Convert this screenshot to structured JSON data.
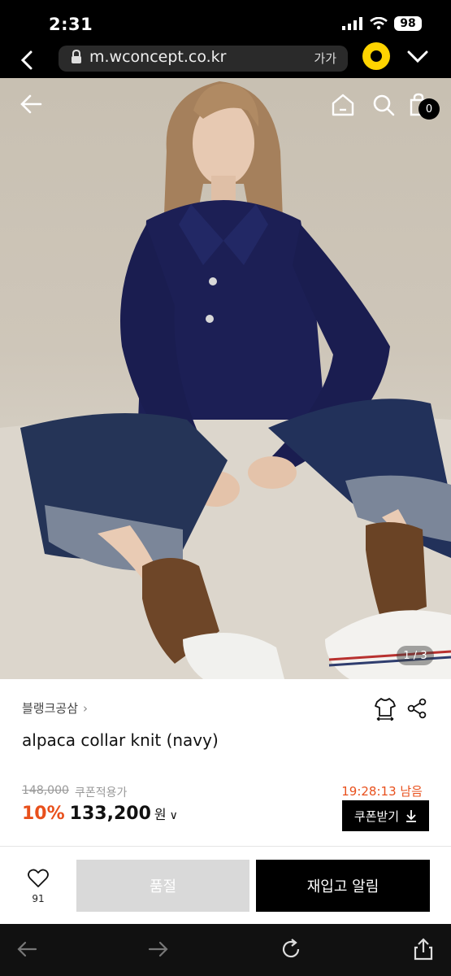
{
  "status": {
    "time": "2:31",
    "battery": "98"
  },
  "browser": {
    "url": "m.wconcept.co.kr",
    "text_size_label": "가가"
  },
  "gallery": {
    "cart_count": "0",
    "pager": "1 / 3"
  },
  "product": {
    "brand": "블랭크공삼",
    "name": "alpaca collar knit (navy)",
    "original_price": "148,000",
    "coupon_note": "쿠폰적용가",
    "timer": "19:28:13 남음",
    "discount": "10%",
    "price": "133,200",
    "currency": "원",
    "coupon_button": "쿠폰받기"
  },
  "actions": {
    "like_count": "91",
    "soldout_label": "품절",
    "restock_label": "재입고 알림"
  },
  "colors": {
    "accent": "#e8501c",
    "brand_yellow": "#ffd400"
  }
}
